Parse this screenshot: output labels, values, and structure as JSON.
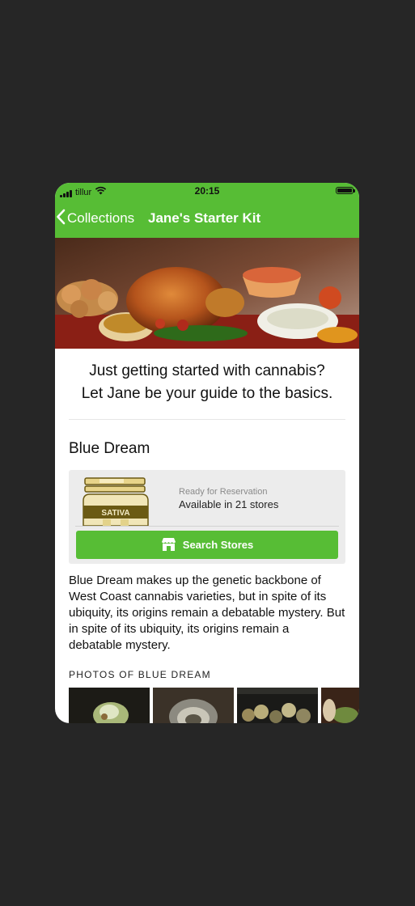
{
  "status_bar": {
    "carrier": "tillur",
    "time": "20:15"
  },
  "nav": {
    "back_label": "Collections",
    "title": "Jane's Starter Kit"
  },
  "intro": {
    "line1": "Just getting started with cannabis?",
    "line2": "Let Jane be your guide to the basics."
  },
  "strain": {
    "name": "Blue Dream",
    "jar_label": "SATIVA",
    "ready_text": "Ready for Reservation",
    "availability": "Available in 21 stores",
    "search_button": "Search Stores",
    "description": "Blue Dream makes up the genetic backbone of West Coast cannabis varieties, but in spite of its ubiquity, its origins remain a debatable mystery. But in spite of its ubiquity, its origins remain a debatable mystery."
  },
  "photos": {
    "heading": "PHOTOS OF BLUE DREAM"
  },
  "colors": {
    "brand_green": "#57bd35",
    "background": "#262626",
    "card_bg": "#ececec"
  },
  "icons": [
    "wifi-icon",
    "battery-icon",
    "chevron-left-icon",
    "store-icon"
  ]
}
